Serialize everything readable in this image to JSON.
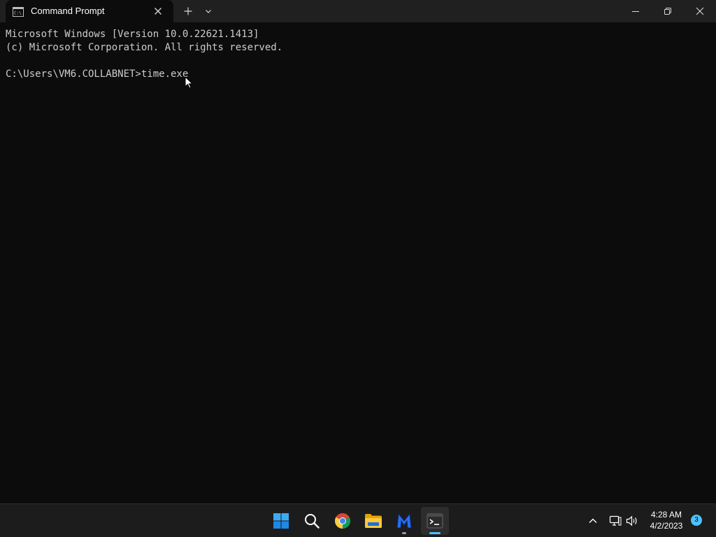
{
  "window": {
    "tab_title": "Command Prompt",
    "tab_icon": "cmd-icon",
    "buttons": {
      "new_tab": "plus-icon",
      "tab_dropdown": "chevron-down-icon",
      "minimize": "minimize-icon",
      "maximize": "restore-icon",
      "close": "close-icon"
    }
  },
  "terminal": {
    "lines": [
      "Microsoft Windows [Version 10.0.22621.1413]",
      "(c) Microsoft Corporation. All rights reserved.",
      "",
      "C:\\Users\\VM6.COLLABNET>time.exe"
    ]
  },
  "taskbar": {
    "apps": [
      {
        "name": "start-icon",
        "state": "normal"
      },
      {
        "name": "search-icon",
        "state": "normal"
      },
      {
        "name": "chrome-icon",
        "state": "normal"
      },
      {
        "name": "file-explorer-icon",
        "state": "normal"
      },
      {
        "name": "malwarebytes-icon",
        "state": "open"
      },
      {
        "name": "terminal-icon",
        "state": "active"
      }
    ],
    "tray": {
      "icons": [
        "chevron-up-icon",
        "network-icon",
        "volume-icon"
      ],
      "time": "4:28 AM",
      "date": "4/2/2023",
      "notification_count": "3"
    }
  },
  "colors": {
    "terminal_bg": "#0c0c0c",
    "terminal_text": "#cccccc",
    "titlebar_bg": "#202020",
    "taskbar_bg": "#1c1c1c",
    "accent": "#4cc2ff"
  }
}
